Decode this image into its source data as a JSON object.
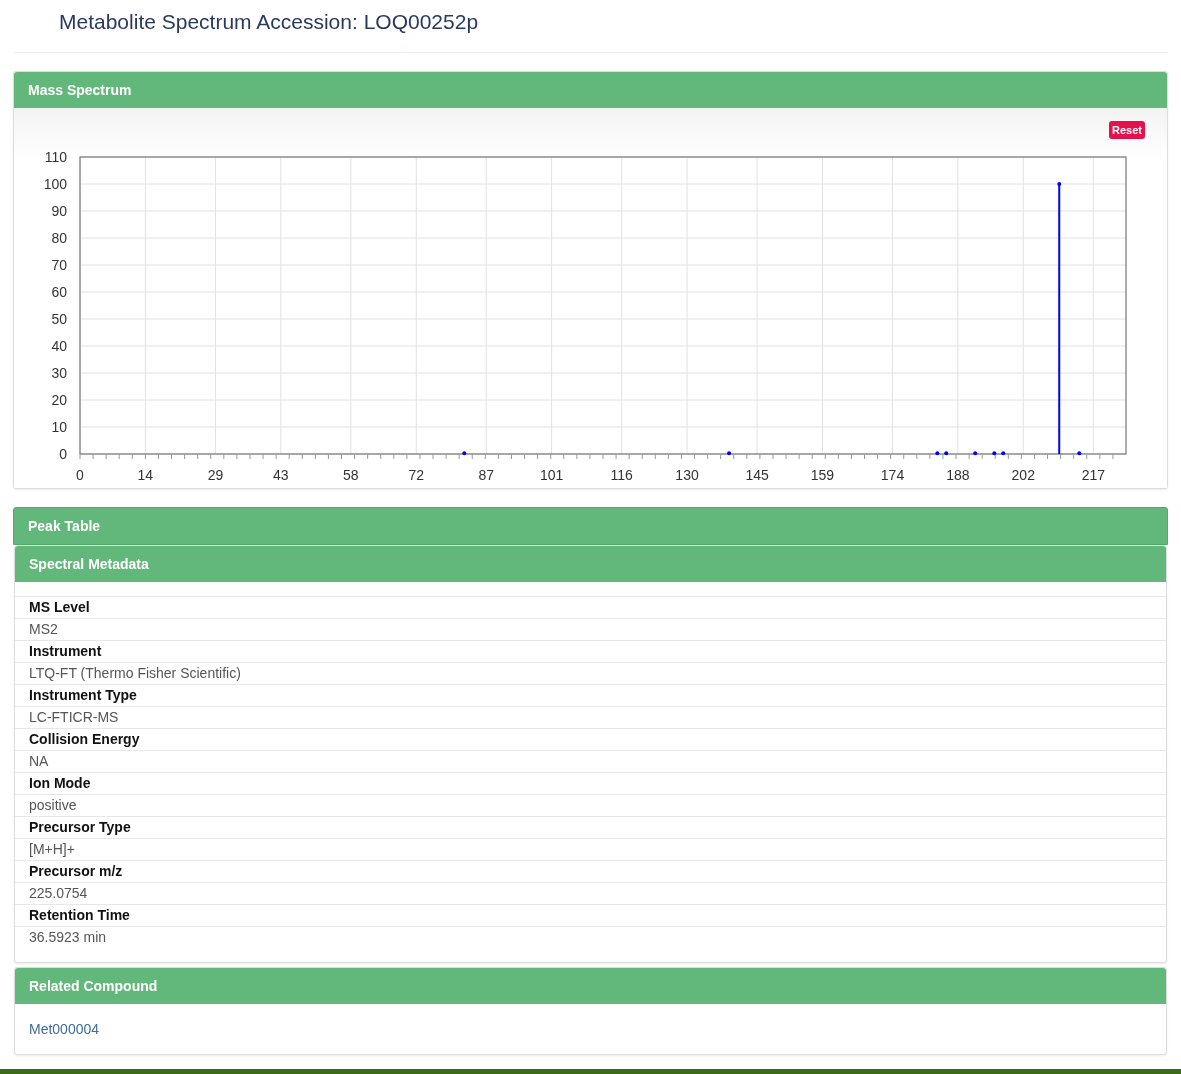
{
  "page_title": "Metabolite Spectrum Accession: LOQ00252p",
  "mass_spectrum": {
    "heading": "Mass Spectrum",
    "reset_button": "Reset",
    "chart_data": {
      "type": "bar",
      "grid": true,
      "xlim": [
        0,
        224
      ],
      "ylim": [
        0,
        110
      ],
      "xticks": [
        0,
        14,
        29,
        43,
        58,
        72,
        87,
        101,
        116,
        130,
        145,
        159,
        174,
        188,
        202,
        217
      ],
      "yticks": [
        0,
        10,
        20,
        30,
        40,
        50,
        60,
        70,
        80,
        90,
        100,
        110
      ],
      "x": [
        82.3,
        139.0,
        183.6,
        185.5,
        191.7,
        195.8,
        197.7,
        209.7,
        214.0
      ],
      "series": [
        {
          "color": "#0000ff",
          "values": [
            0.3,
            0.3,
            0.3,
            0.3,
            0.3,
            0.3,
            0.3,
            100,
            0.3
          ]
        }
      ]
    }
  },
  "peak_table": {
    "heading": "Peak Table"
  },
  "spectral_metadata": {
    "heading": "Spectral Metadata",
    "fields": [
      {
        "label": "MS Level",
        "value": "MS2"
      },
      {
        "label": "Instrument",
        "value": "LTQ-FT (Thermo Fisher Scientific)"
      },
      {
        "label": "Instrument Type",
        "value": "LC-FTICR-MS"
      },
      {
        "label": "Collision Energy",
        "value": "NA"
      },
      {
        "label": "Ion Mode",
        "value": "positive"
      },
      {
        "label": "Precursor Type",
        "value": "[M+H]+"
      },
      {
        "label": "Precursor m/z",
        "value": "225.0754"
      },
      {
        "label": "Retention Time",
        "value": "36.5923 min"
      }
    ]
  },
  "related_compound": {
    "heading": "Related Compound",
    "link": "Met000004"
  }
}
